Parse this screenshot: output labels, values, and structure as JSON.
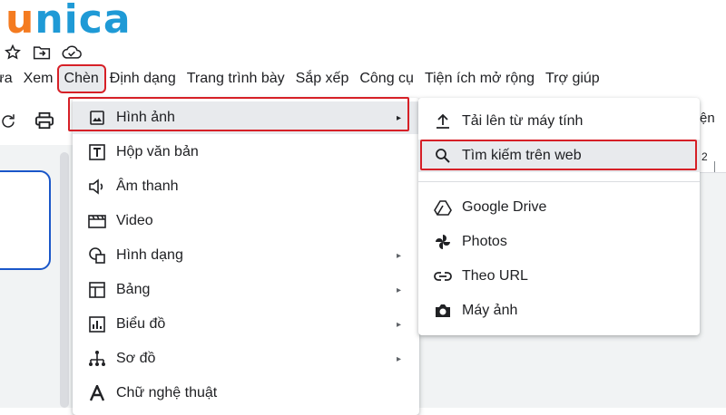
{
  "logo": {
    "first": "u",
    "rest": "nica"
  },
  "top_icons": [
    "star-icon",
    "move-to-folder-icon",
    "cloud-saved-icon"
  ],
  "menubar": {
    "items": [
      {
        "label": "ửa"
      },
      {
        "label": "Xem"
      },
      {
        "label": "Chèn",
        "active": true
      },
      {
        "label": "Định dạng"
      },
      {
        "label": "Trang trình bày"
      },
      {
        "label": "Sắp xếp"
      },
      {
        "label": "Công cụ"
      },
      {
        "label": "Tiện ích mở rộng"
      },
      {
        "label": "Trợ giúp"
      }
    ]
  },
  "toolbar_icons": [
    "redo-icon",
    "print-icon"
  ],
  "insert_menu": {
    "items": [
      {
        "label": "Hình ảnh",
        "icon": "image-icon",
        "submenu": true,
        "highlighted": true
      },
      {
        "label": "Hộp văn bản",
        "icon": "text-box-icon",
        "submenu": false
      },
      {
        "label": "Âm thanh",
        "icon": "audio-icon",
        "submenu": false
      },
      {
        "label": "Video",
        "icon": "video-icon",
        "submenu": false
      },
      {
        "label": "Hình dạng",
        "icon": "shape-icon",
        "submenu": true
      },
      {
        "label": "Bảng",
        "icon": "table-icon",
        "submenu": true
      },
      {
        "label": "Biểu đồ",
        "icon": "chart-icon",
        "submenu": true
      },
      {
        "label": "Sơ đồ",
        "icon": "diagram-icon",
        "submenu": true
      },
      {
        "label": "Chữ nghệ thuật",
        "icon": "word-art-icon",
        "submenu": false
      }
    ],
    "submenu_arrow": "▸"
  },
  "image_submenu": {
    "items": [
      {
        "label": "Tải lên từ máy tính",
        "icon": "upload-icon"
      },
      {
        "label": "Tìm kiếm trên web",
        "icon": "search-icon",
        "highlighted": true
      },
      {
        "label": "Google Drive",
        "icon": "google-drive-icon"
      },
      {
        "label": "Photos",
        "icon": "photos-icon"
      },
      {
        "label": "Theo URL",
        "icon": "link-icon"
      },
      {
        "label": "Máy ảnh",
        "icon": "camera-icon"
      }
    ]
  },
  "partial_right_text": "ện",
  "ruler_number": "2",
  "colors": {
    "highlight_border": "#d62027",
    "logo_orange": "#f47b20",
    "logo_blue": "#1f9ad6",
    "shape_border": "#1a57c9"
  }
}
